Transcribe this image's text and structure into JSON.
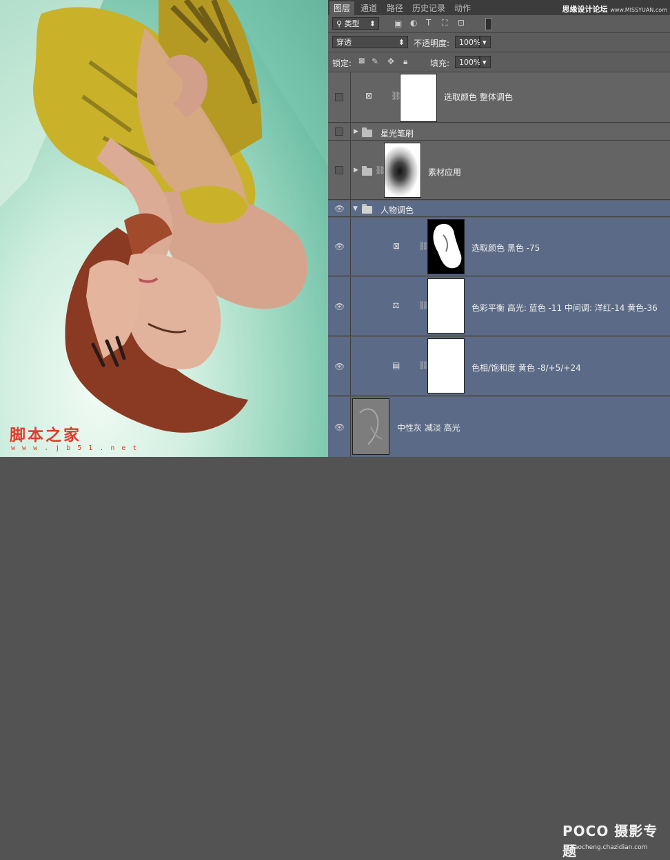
{
  "photo": {
    "watermark": "脚本之家",
    "watermark_url": "w w w . j b 5 1 . n e t"
  },
  "tabs": [
    "图层",
    "通道",
    "路径",
    "历史记录",
    "动作"
  ],
  "site_watermark": {
    "main": "思缘设计论坛",
    "url": "www.MISSYUAN.com"
  },
  "filter_row": {
    "kind": "类型"
  },
  "blend_row": {
    "mode": "穿透",
    "opacity_label": "不透明度:",
    "opacity": "100%"
  },
  "lock_row": {
    "lock_label": "锁定:",
    "fill_label": "填充:",
    "fill": "100%"
  },
  "layers": [
    {
      "name": "选取颜色 整体调色",
      "visible": false,
      "type": "selective-color"
    },
    {
      "name": "星光笔刷",
      "visible": false,
      "type": "group"
    },
    {
      "name": "素材应用",
      "visible": false,
      "type": "group-masked"
    },
    {
      "name": "人物调色",
      "visible": true,
      "type": "group-open"
    },
    {
      "name": "选取颜色 黑色 -75",
      "visible": true,
      "type": "selective-color"
    },
    {
      "name": "色彩平衡 高光: 蓝色 -11 中间调: 洋红-14 黄色-36",
      "visible": true,
      "type": "color-balance"
    },
    {
      "name": "色相/饱和度 黄色 -8/+5/+24",
      "visible": true,
      "type": "hue-saturation"
    },
    {
      "name": "中性灰 减淡 高光",
      "visible": true,
      "type": "pixel"
    }
  ],
  "corner_watermark": {
    "main": "POCO 摄影专题",
    "url": "jiaocheng.chazidian.com"
  }
}
